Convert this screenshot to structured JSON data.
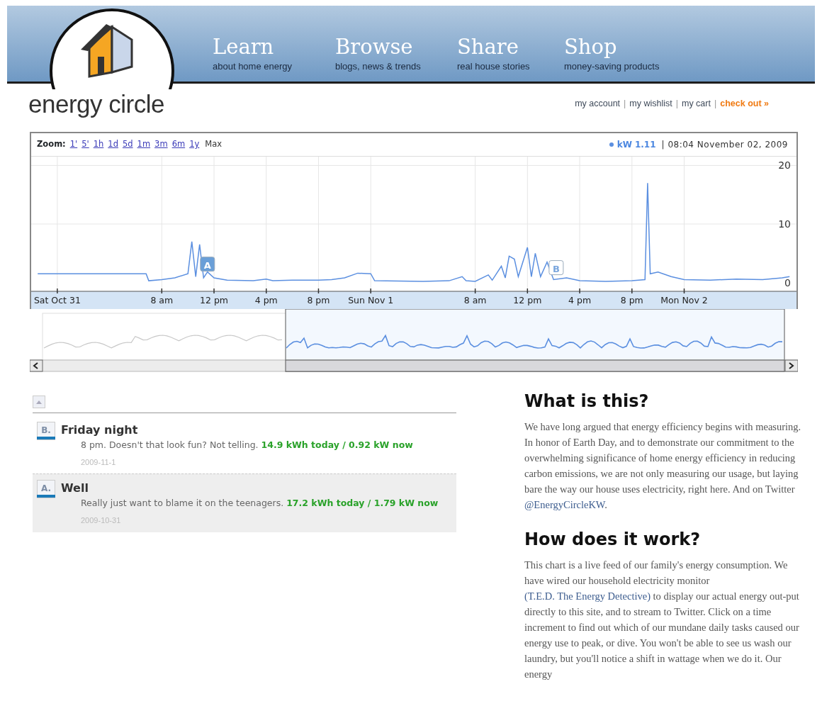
{
  "site": {
    "name": "energy circle"
  },
  "nav": [
    {
      "title": "Learn",
      "subtitle": "about home energy"
    },
    {
      "title": "Browse",
      "subtitle": "blogs, news & trends"
    },
    {
      "title": "Share",
      "subtitle": "real house stories"
    },
    {
      "title": "Shop",
      "subtitle": "money-saving products"
    }
  ],
  "account_links": [
    {
      "label": "my account",
      "kind": "plain"
    },
    {
      "label": "my wishlist",
      "kind": "plain"
    },
    {
      "label": "my cart",
      "kind": "plain"
    },
    {
      "label": "check out »",
      "kind": "emphasis"
    }
  ],
  "account_separator": "|",
  "chart_panel": {
    "zoom_label": "Zoom:",
    "zoom_options": [
      {
        "label": "1'",
        "selected": false
      },
      {
        "label": "5'",
        "selected": false
      },
      {
        "label": "1h",
        "selected": false
      },
      {
        "label": "1d",
        "selected": false
      },
      {
        "label": "5d",
        "selected": false
      },
      {
        "label": "1m",
        "selected": false
      },
      {
        "label": "3m",
        "selected": false
      },
      {
        "label": "6m",
        "selected": false
      },
      {
        "label": "1y",
        "selected": false
      },
      {
        "label": "Max",
        "selected": true
      }
    ],
    "legend_value": "1.11",
    "flags": [
      {
        "text": "A",
        "color": "#6a9fd8"
      },
      {
        "text": "B",
        "color": "#ffffff"
      }
    ],
    "legend_time": "| 08:04 November 02, 2009",
    "chart_data": {
      "type": "line",
      "xlim": [
        "2009-10-30T22:00",
        "2009-11-02T08:36"
      ],
      "ylim": [
        -1.5,
        21.5
      ],
      "grid": true,
      "xticks": [
        {
          "value": "2009-10-31T00:00",
          "label": "Sat Oct 31"
        },
        {
          "value": "2009-10-31T08:00",
          "label": "8 am"
        },
        {
          "value": "2009-10-31T12:00",
          "label": "12 pm"
        },
        {
          "value": "2009-10-31T16:00",
          "label": "4 pm"
        },
        {
          "value": "2009-10-31T20:00",
          "label": "8 pm"
        },
        {
          "value": "2009-11-01T00:00",
          "label": "Sun Nov 1"
        },
        {
          "value": "2009-11-01T08:00",
          "label": "8 am"
        },
        {
          "value": "2009-11-01T12:00",
          "label": "12 pm"
        },
        {
          "value": "2009-11-01T16:00",
          "label": "4 pm"
        },
        {
          "value": "2009-11-01T20:00",
          "label": "8 pm"
        },
        {
          "value": "2009-11-02T00:00",
          "label": "Mon Nov 2"
        }
      ],
      "yticks": [
        0,
        10,
        20
      ],
      "x": [
        "2009-10-30T22:30",
        "2009-10-31T06:48",
        "2009-10-31T07:00",
        "2009-10-31T08:00",
        "2009-10-31T09:00",
        "2009-10-31T10:00",
        "2009-10-31T10:18",
        "2009-10-31T10:36",
        "2009-10-31T10:54",
        "2009-10-31T11:12",
        "2009-10-31T11:30",
        "2009-10-31T12:00",
        "2009-10-31T13:00",
        "2009-10-31T15:00",
        "2009-10-31T16:00",
        "2009-10-31T16:30",
        "2009-10-31T18:00",
        "2009-10-31T20:00",
        "2009-10-31T21:00",
        "2009-10-31T22:00",
        "2009-10-31T23:00",
        "2009-11-01T00:00",
        "2009-11-01T00:18",
        "2009-11-01T04:00",
        "2009-11-01T06:00",
        "2009-11-01T07:00",
        "2009-11-01T07:18",
        "2009-11-01T08:00",
        "2009-11-01T09:00",
        "2009-11-01T09:18",
        "2009-11-01T10:00",
        "2009-11-01T10:18",
        "2009-11-01T10:36",
        "2009-11-01T11:00",
        "2009-11-01T11:18",
        "2009-11-01T12:00",
        "2009-11-01T12:18",
        "2009-11-01T12:36",
        "2009-11-01T13:00",
        "2009-11-01T13:30",
        "2009-11-01T14:00",
        "2009-11-01T15:00",
        "2009-11-01T16:00",
        "2009-11-01T18:00",
        "2009-11-01T20:00",
        "2009-11-01T21:00",
        "2009-11-01T21:12",
        "2009-11-01T21:24",
        "2009-11-01T22:00",
        "2009-11-01T23:00",
        "2009-11-02T00:00",
        "2009-11-02T02:00",
        "2009-11-02T04:00",
        "2009-11-02T06:00",
        "2009-11-02T07:30",
        "2009-11-02T08:04"
      ],
      "series": [
        {
          "name": "kW",
          "color": "#5b8fe0",
          "values": [
            1.5,
            1.5,
            0.3,
            0.5,
            0.8,
            1.5,
            7,
            1,
            6.5,
            0.8,
            1.8,
            0.8,
            0.4,
            0.3,
            0.6,
            0.3,
            0.4,
            0.4,
            0.5,
            0.8,
            1.6,
            1.5,
            0.3,
            0.2,
            0.3,
            1,
            0.3,
            0.2,
            1.3,
            0.4,
            2.8,
            0.8,
            4.5,
            4,
            1,
            6,
            1,
            5,
            1,
            3.5,
            0.5,
            0.8,
            0.3,
            0.2,
            0.3,
            0.5,
            17,
            1.5,
            1.8,
            1,
            0.5,
            0.4,
            0.6,
            0.5,
            0.8,
            1
          ]
        }
      ]
    }
  },
  "entries": [
    {
      "marker": "B.",
      "title": "Friday night",
      "text": "8 pm. Doesn't that look fun? Not telling.",
      "stats": "14.9 kWh today / 0.92 kW now",
      "date": "2009-11-1",
      "selected": false
    },
    {
      "marker": "A.",
      "title": "Well",
      "text": "Really just want to blame it on the teenagers.",
      "stats": "17.2 kWh today / 1.79 kW now",
      "date": "2009-10-31",
      "selected": true
    }
  ],
  "about": [
    {
      "heading": "What is this?",
      "paragraph": [
        {
          "kind": "text",
          "text": "We have long argued that energy efficiency begins with measuring. In honor of Earth Day, and to demonstrate our commitment to the overwhelming significance of home energy efficiency in reducing carbon emissions, we are not only measuring our usage, but laying bare the way our house uses electricity, right here. And on Twitter "
        },
        {
          "kind": "link",
          "text": "@EnergyCircleKW"
        },
        {
          "kind": "text",
          "text": "."
        }
      ]
    },
    {
      "heading": "How does it work?",
      "paragraph": [
        {
          "kind": "text",
          "text": "This chart is a live feed of our family's energy consumption. We have wired our household electricity monitor "
        },
        {
          "kind": "link",
          "text": "(T.E.D. The Energy Detective)"
        },
        {
          "kind": "text",
          "text": " to display our actual energy out-put directly to this site, and to stream to Twitter. Click on a time increment to find out which of our mundane daily tasks caused our energy use to peak, or dive. You won't be able to see us wash our laundry, but you'll notice a shift in wattage when we do it. Our energy"
        }
      ]
    }
  ]
}
